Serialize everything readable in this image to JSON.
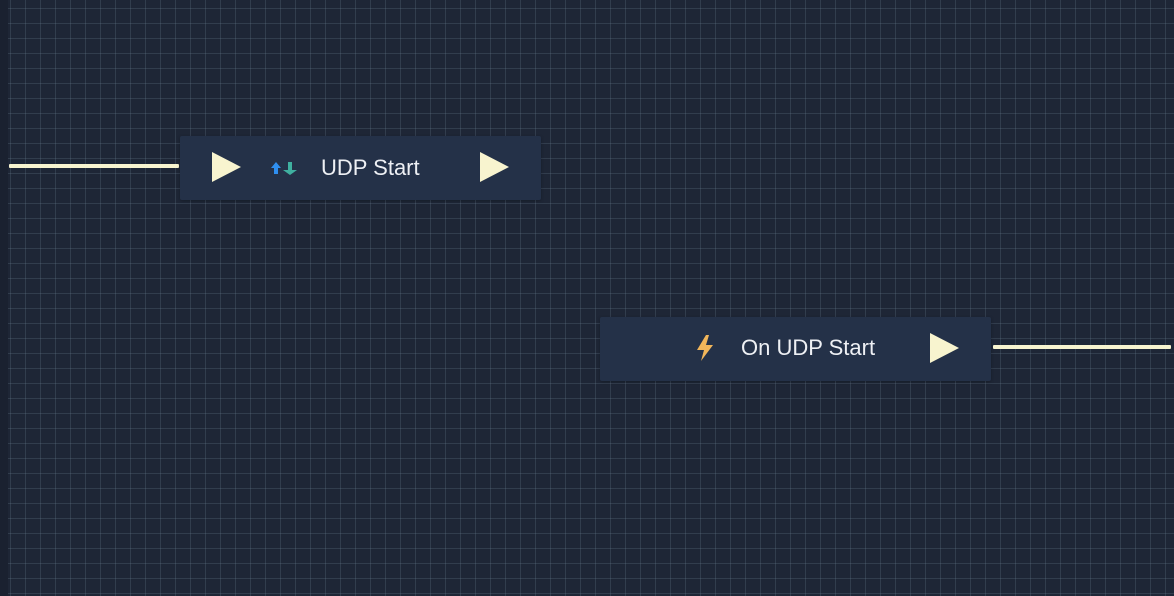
{
  "graph": {
    "nodes": [
      {
        "label": "UDP Start",
        "icon": "udp-arrows-icon"
      },
      {
        "label": "On UDP Start",
        "icon": "lightning-bolt-icon"
      }
    ]
  },
  "colors": {
    "canvas_background": "#1e2636",
    "grid_line": "#3a4658",
    "node_background": "#243148",
    "wire": "#f8f4cf",
    "exec_pin": "#f8f4cf",
    "arrow_up": "#2f8ff0",
    "arrow_down": "#3fb0a0",
    "lightning": "#f2b65a"
  }
}
